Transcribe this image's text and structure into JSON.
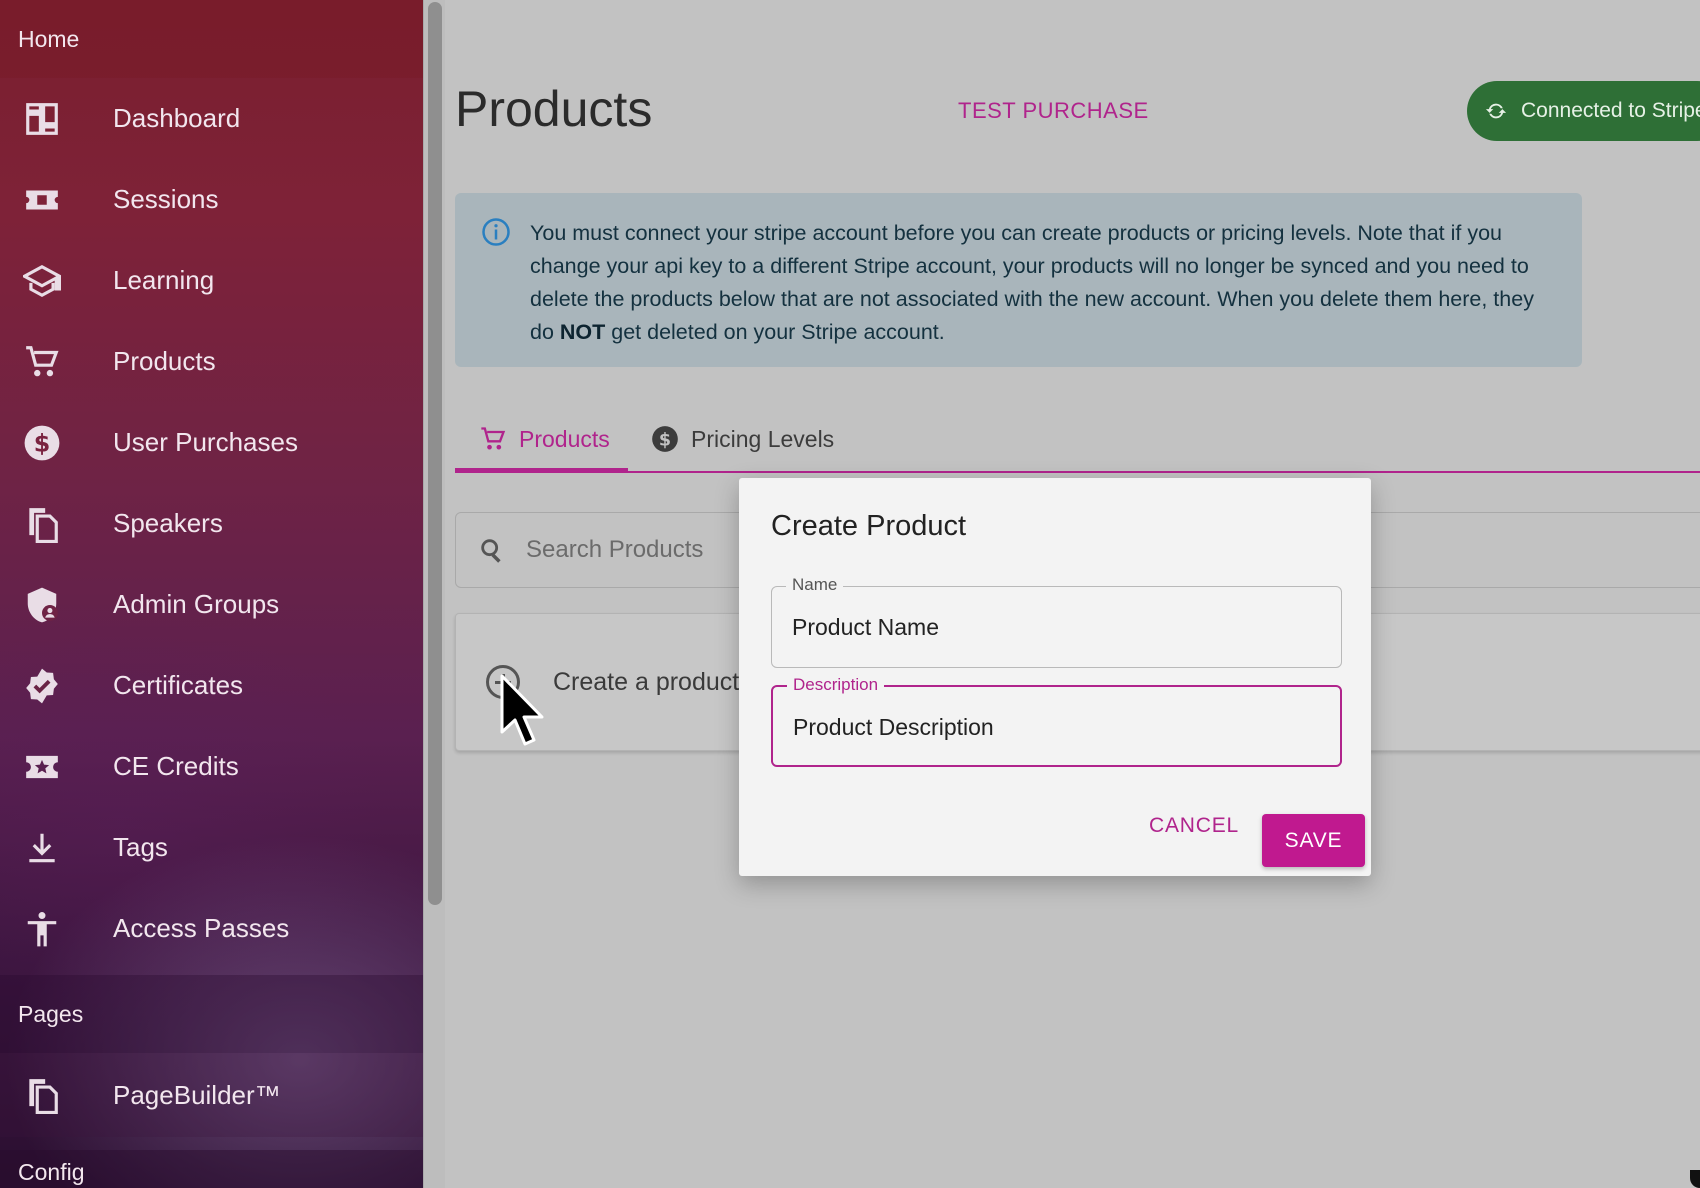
{
  "sidebar": {
    "home_header": "Home",
    "pages_header": "Pages",
    "config_header": "Config",
    "items": [
      {
        "label": "Dashboard",
        "icon": "dashboard-icon"
      },
      {
        "label": "Sessions",
        "icon": "ticket-icon"
      },
      {
        "label": "Learning",
        "icon": "school-icon"
      },
      {
        "label": "Products",
        "icon": "cart-icon"
      },
      {
        "label": "User Purchases",
        "icon": "dollar-circle-icon"
      },
      {
        "label": "Speakers",
        "icon": "copy-icon"
      },
      {
        "label": "Admin Groups",
        "icon": "shield-user-icon"
      },
      {
        "label": "Certificates",
        "icon": "verified-badge-icon"
      },
      {
        "label": "CE Credits",
        "icon": "star-ticket-icon"
      },
      {
        "label": "Tags",
        "icon": "download-icon"
      },
      {
        "label": "Access Passes",
        "icon": "accessibility-icon"
      }
    ],
    "pagebuilder": {
      "label": "PageBuilder™",
      "icon": "copy-icon"
    }
  },
  "header": {
    "title": "Products",
    "test_purchase": "TEST PURCHASE",
    "stripe_status": "Connected to Stripe"
  },
  "alert": {
    "text_before": "You must connect your stripe account before you can create products or pricing levels. Note that if you change your api key to a different Stripe account, your products will no longer be synced and you need to delete the products below that are not associated with the new account. When you delete them here, they do ",
    "bold": "NOT",
    "text_after": " get deleted on your Stripe account."
  },
  "tabs": [
    {
      "label": "Products",
      "active": true
    },
    {
      "label": "Pricing Levels",
      "active": false
    }
  ],
  "search": {
    "placeholder": "Search Products"
  },
  "create_card": {
    "label": "Create a product"
  },
  "dialog": {
    "title": "Create Product",
    "name_label": "Name",
    "name_value": "Product Name",
    "description_label": "Description",
    "description_value": "Product Description",
    "cancel": "CANCEL",
    "save": "SAVE"
  },
  "colors": {
    "accent": "#b0248c",
    "stripe_green": "#2e6f36",
    "alert_bg": "#a9b5bb"
  }
}
